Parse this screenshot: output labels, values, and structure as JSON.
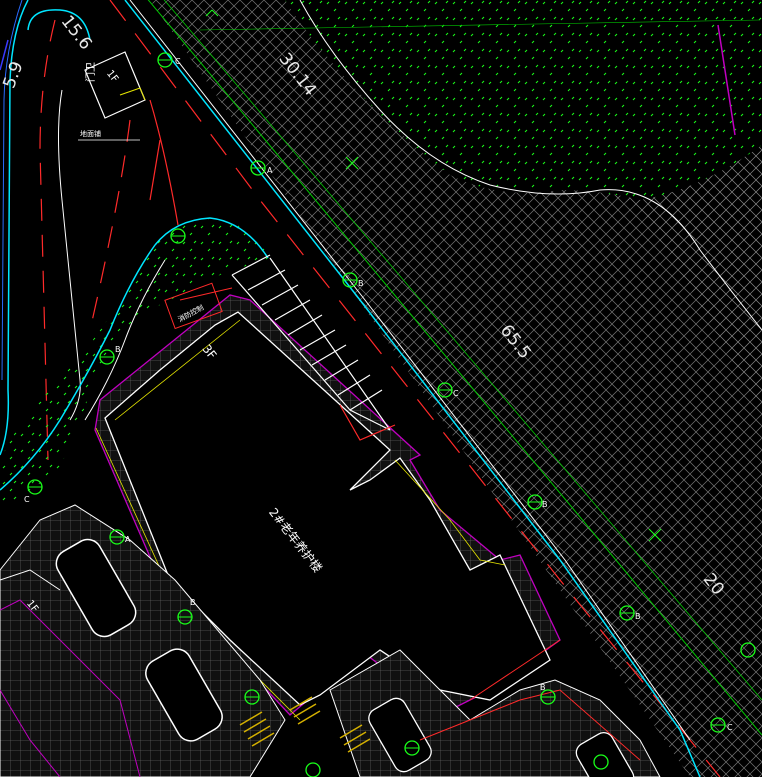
{
  "drawing": {
    "building_label": "2#老年养护楼",
    "floor_label_3f": "3F",
    "floor_label_1f_top": "1F",
    "floor_label_1f_left": "1F",
    "room_label_top": "门卫",
    "note_label": "地面铺",
    "building_tag_top": "消防控制",
    "dim_top_left": "15.6",
    "dim_left_edge": "5.9",
    "dim_center": "30.14",
    "dim_right": "65.5",
    "dim_bottom_right": "20",
    "marker_a": "A",
    "marker_b": "B",
    "marker_c": "C"
  },
  "colors": {
    "background": "#000000",
    "curb": "#00e5ff",
    "road_edge": "#ffffff",
    "centerline": "#ff2a2a",
    "grass": "#19ff19",
    "hatch": "#bfbfbf",
    "building_outline": "#c000c0",
    "paving": "#6a6a6a",
    "survey_line": "#00c800",
    "dim_text": "#e8e8e8",
    "yellow": "#e6e600"
  },
  "icons": [
    "tree-symbol-icon",
    "grass-dot-icon",
    "crosshatch-pattern-icon",
    "parking-stripes-icon"
  ]
}
